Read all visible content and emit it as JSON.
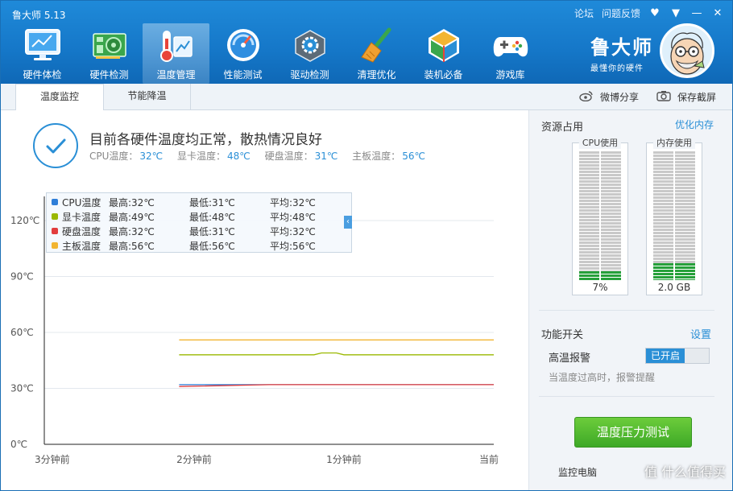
{
  "window": {
    "title": "鲁大师 5.13",
    "links": [
      "论坛",
      "问题反馈"
    ],
    "icons": [
      "skin-icon",
      "menu-icon",
      "minimize-icon",
      "close-icon"
    ]
  },
  "toolbar": {
    "items": [
      {
        "label": "硬件体检",
        "icon": "monitor-icon"
      },
      {
        "label": "硬件检测",
        "icon": "circuit-board-icon"
      },
      {
        "label": "温度管理",
        "icon": "thermometer-icon",
        "active": true
      },
      {
        "label": "性能测试",
        "icon": "speedometer-icon"
      },
      {
        "label": "驱动检测",
        "icon": "gear-box-icon"
      },
      {
        "label": "清理优化",
        "icon": "broom-icon"
      },
      {
        "label": "装机必备",
        "icon": "cube-icon"
      },
      {
        "label": "游戏库",
        "icon": "gamepad-icon"
      }
    ]
  },
  "brand": {
    "name": "鲁大师",
    "slogan": "最懂你的硬件"
  },
  "subtabs": {
    "tab1": "温度监控",
    "tab2": "节能降温",
    "share": "微博分享",
    "screenshot": "保存截屏"
  },
  "status": {
    "title": "目前各硬件温度均正常，散热情况良好",
    "cpu_label": "CPU温度：",
    "cpu_value": "32℃",
    "gpu_label": "显卡温度：",
    "gpu_value": "48℃",
    "disk_label": "硬盘温度：",
    "disk_value": "31℃",
    "board_label": "主板温度：",
    "board_value": "56℃"
  },
  "legend": [
    {
      "name": "CPU温度",
      "max": "最高:32℃",
      "min": "最低:31℃",
      "avg": "平均:32℃",
      "color": "#2f7ed8"
    },
    {
      "name": "显卡温度",
      "max": "最高:49℃",
      "min": "最低:48℃",
      "avg": "平均:48℃",
      "color": "#9ab800"
    },
    {
      "name": "硬盘温度",
      "max": "最高:32℃",
      "min": "最低:31℃",
      "avg": "平均:32℃",
      "color": "#e23d3d"
    },
    {
      "name": "主板温度",
      "max": "最高:56℃",
      "min": "最低:56℃",
      "avg": "平均:56℃",
      "color": "#f2b531"
    }
  ],
  "chart_data": {
    "type": "line",
    "x_labels": [
      "3分钟前",
      "2分钟前",
      "1分钟前",
      "当前"
    ],
    "y_ticks": [
      "0℃",
      "30℃",
      "60℃",
      "90℃",
      "120℃"
    ],
    "ylim": [
      0,
      120
    ],
    "x_minutes_ago_range": [
      3,
      0
    ],
    "grid": true,
    "series": [
      {
        "name": "CPU温度",
        "color": "#2f7ed8",
        "x": [
          2.1,
          1.9,
          1.3,
          1.0,
          0.5,
          0.1,
          0
        ],
        "y": [
          32,
          32,
          32,
          32,
          32,
          32,
          32
        ]
      },
      {
        "name": "显卡温度",
        "color": "#9ab800",
        "x": [
          2.1,
          1.2,
          1.15,
          1.05,
          1.0,
          0
        ],
        "y": [
          48,
          48,
          49,
          49,
          48,
          48
        ]
      },
      {
        "name": "硬盘温度",
        "color": "#e23d3d",
        "x": [
          2.1,
          1.5,
          1.0,
          0.5,
          0
        ],
        "y": [
          31,
          32,
          32,
          32,
          32
        ]
      },
      {
        "name": "主板温度",
        "color": "#f2b531",
        "x": [
          2.1,
          1.0,
          0
        ],
        "y": [
          56,
          56,
          56
        ]
      }
    ]
  },
  "side": {
    "resources_title": "资源占用",
    "optimize_link": "优化内存",
    "cpu_title": "CPU使用",
    "cpu_value": "7%",
    "cpu_fraction": 0.07,
    "mem_title": "内存使用",
    "mem_value": "2.0 GB",
    "mem_fraction": 0.13,
    "switch_title": "功能开关",
    "settings_link": "设置",
    "alarm_label": "高温报警",
    "alarm_state": "已开启",
    "alarm_hint": "当温度过高时，报警提醒",
    "stress_button": "温度压力测试",
    "monitor_link": "监控电脑",
    "watermark": "值 什么值得买"
  }
}
